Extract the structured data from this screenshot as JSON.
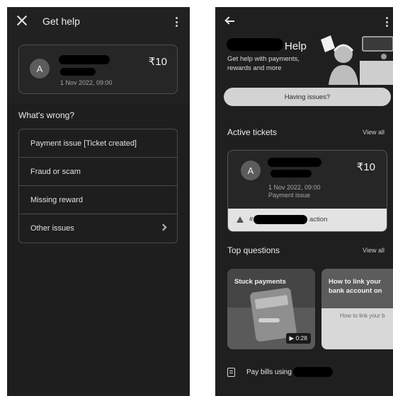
{
  "left_screen": {
    "header": {
      "title": "Get help"
    },
    "transaction": {
      "avatar_initial": "A",
      "amount": "₹10",
      "date": "1 Nov 2022, 09:00"
    },
    "section_title": "What's wrong?",
    "issues": [
      {
        "label": "Payment issue [Ticket created]"
      },
      {
        "label": "Fraud or scam"
      },
      {
        "label": "Missing reward"
      },
      {
        "label": "Other issues"
      }
    ]
  },
  "right_screen": {
    "hero": {
      "title": "Help",
      "subtitle": "Get help with payments, rewards and more"
    },
    "issues_button": "Having issues?",
    "active_tickets": {
      "heading": "Active tickets",
      "view_all": "View all",
      "ticket": {
        "avatar_initial": "A",
        "amount": "₹10",
        "date": "1 Nov 2022, 09:00",
        "category": "Payment issue",
        "banner_prefix": "#",
        "banner_suffix": "action"
      }
    },
    "top_questions": {
      "heading": "Top questions",
      "view_all": "View all",
      "videos": [
        {
          "title": "Stuck payments",
          "duration": "▶ 0:28"
        },
        {
          "title": "How to link your bank account on",
          "subtitle": "How to link your b"
        }
      ]
    },
    "bill_row": {
      "label": "Pay bills using"
    }
  },
  "colors": {
    "background": "#212121",
    "card_border": "#4d4d4d",
    "pill": "#d3d3d3",
    "redaction": "#000000"
  }
}
